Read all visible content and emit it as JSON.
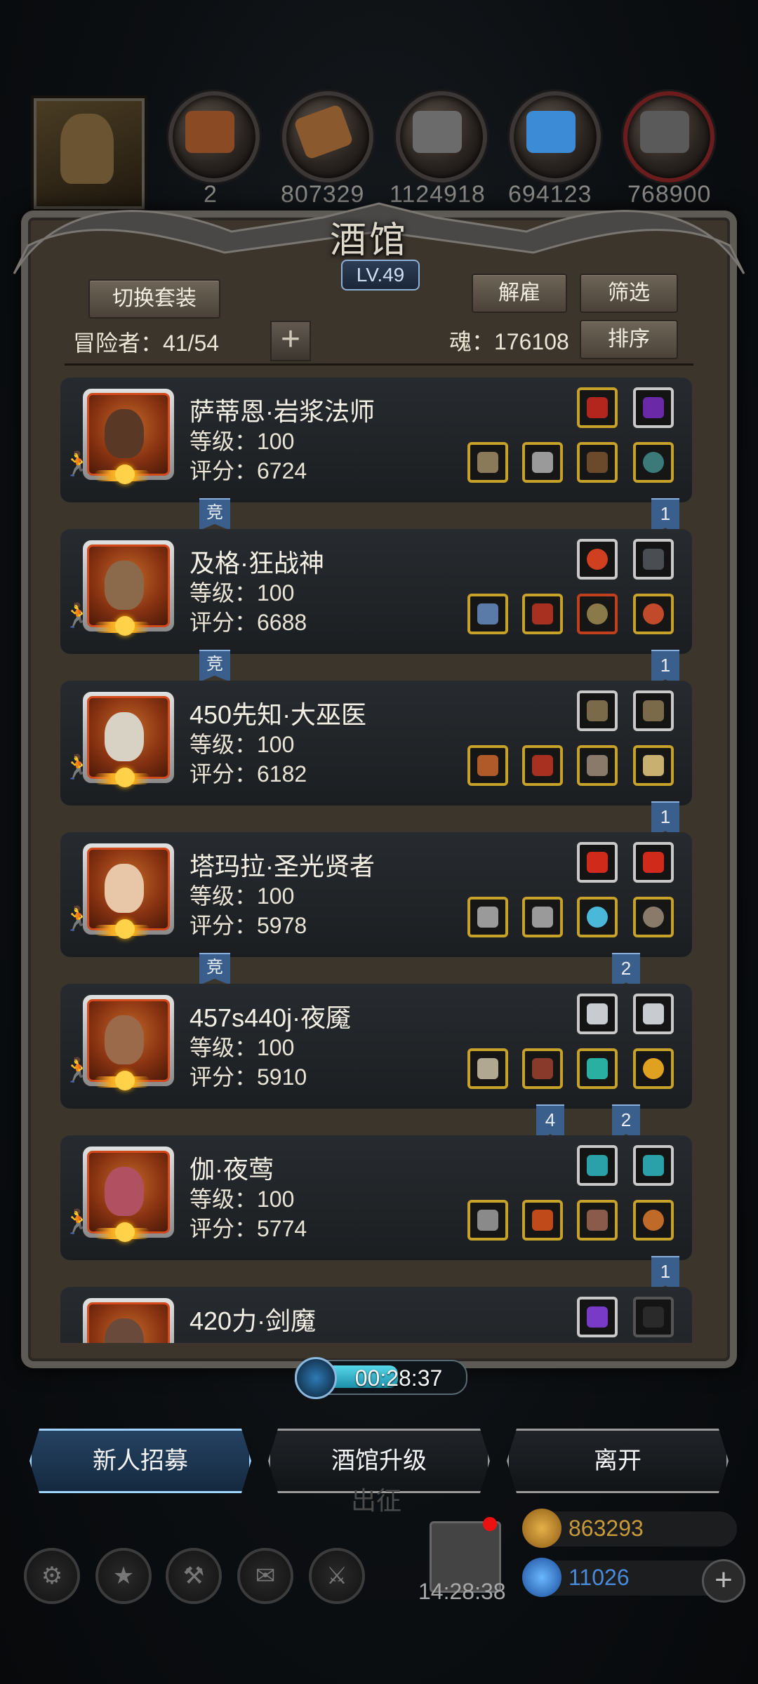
{
  "top_bar": {
    "resources": [
      {
        "name": "resource-1-icon",
        "value": "2"
      },
      {
        "name": "resource-2-icon",
        "value": "807329"
      },
      {
        "name": "resource-3-icon",
        "value": "1124918"
      },
      {
        "name": "resource-4-icon",
        "value": "694123"
      },
      {
        "name": "resource-5-icon",
        "value": "768900"
      }
    ]
  },
  "tavern": {
    "title": "酒馆",
    "level": "LV.49",
    "switch_set_label": "切换套装",
    "dismiss_label": "解雇",
    "filter_label": "筛选",
    "sort_label": "排序",
    "adventurer_label": "冒险者：41/54",
    "soul_label": "魂：176108",
    "add_label": "+"
  },
  "heroes": [
    {
      "name": "萨蒂恩·岩浆法师",
      "level": "等级：100",
      "score": "评分：6724",
      "compete": "竞",
      "badges": [
        "1"
      ]
    },
    {
      "name": "及格·狂战神",
      "level": "等级：100",
      "score": "评分：6688",
      "compete": "竞",
      "badges": [
        "1"
      ]
    },
    {
      "name": "450先知·大巫医",
      "level": "等级：100",
      "score": "评分：6182",
      "compete": "",
      "badges": [
        "1"
      ]
    },
    {
      "name": "塔玛拉·圣光贤者",
      "level": "等级：100",
      "score": "评分：5978",
      "compete": "竞",
      "badges": [
        "2"
      ]
    },
    {
      "name": "457s440j·夜魇",
      "level": "等级：100",
      "score": "评分：5910",
      "compete": "",
      "badges": [
        "4",
        "2"
      ]
    },
    {
      "name": "伽·夜莺",
      "level": "等级：100",
      "score": "评分：5774",
      "compete": "",
      "badges": [
        "1"
      ]
    },
    {
      "name": "420力·剑魔",
      "level": "",
      "score": "",
      "compete": "",
      "badges": []
    }
  ],
  "timer": {
    "text": "00:28:37",
    "progress": 0.55
  },
  "actions": {
    "recruit": "新人招募",
    "upgrade": "酒馆升级",
    "leave": "离开"
  },
  "footer": {
    "behind_text": "出征",
    "gift_time": "14:28:38",
    "gold": "863293",
    "gems": "11026",
    "plus": "+"
  },
  "colors": {
    "gold_frame": "#c7a22a",
    "blue_ribbon": "#3b5f8c",
    "active_button": "#9fd4ff"
  }
}
